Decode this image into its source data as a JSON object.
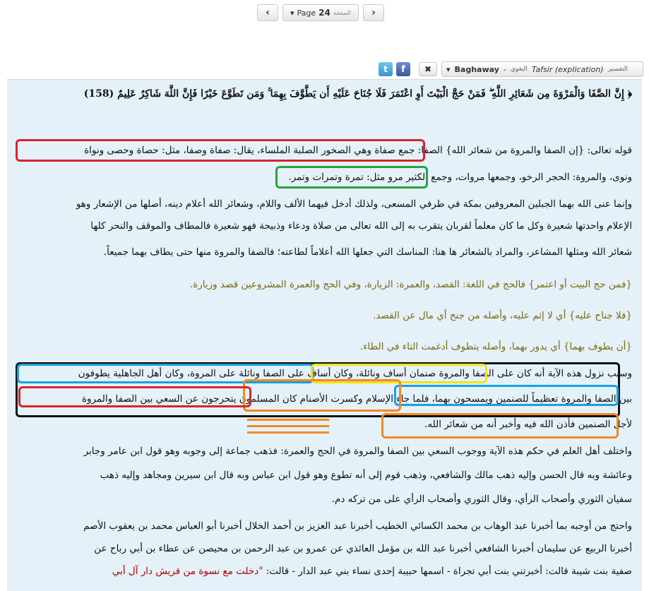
{
  "pager": {
    "prev_symbol": "‹",
    "next_symbol": "›",
    "page_label": "Page",
    "page_number": "24",
    "page_label_ar": "الصفحة",
    "dropdown_symbol": "▾"
  },
  "toolbar": {
    "twitter_label": "t",
    "facebook_label": "f",
    "close_symbol": "✖",
    "book": {
      "name": "Baghaway",
      "separator": "-",
      "name_ar": "البغوي",
      "type": "Tafsir (explication)",
      "type_ar": "التفسير",
      "dropdown_symbol": "▾"
    }
  },
  "content": {
    "lines": [
      "﴿ إِنَّ الصَّفَا وَالْمَرْوَةَ مِن شَعَائِرِ اللَّهِ ۖ فَمَنْ حَجَّ الْبَيْتَ أَوِ اعْتَمَرَ فَلَا جُنَاحَ عَلَيْهِ أَن يَطَّوَّفَ بِهِمَا ۚ وَمَن تَطَوَّعَ خَيْرًا فَإِنَّ اللَّهَ شَاكِرٌ عَلِيمٌ (158)",
      "قوله تعالى: {إن الصفا والمروة من شعائر الله} الصفا: جمع صفاة وهي الصخور الصلبة الملساء، يقال: صفاة وصفا، مثل: حصاة وحصى ونواة",
      "ونوى، والمروة: الحجر الرخو، وجمعها مروات، وجمع الكثير مرو مثل: تمرة وتمرات وتمر.",
      "وإنما عنى الله بهما الجبلين المعروفين بمكة في طرفي المسعى، ولذلك أدخل فيهما الألف واللام، وشعائر الله أعلام دينه، أصلها من الإشعار وهو",
      "الإعلام واحدتها شعيرة وكل ما كان معلماً لقربان يتقرب به إلى الله تعالى من صلاة ودعاء وذبيحة فهو شعيرة فالمطاف والموقف والنحر كلها",
      "شعائر الله ومثلها المشاعر، والمراد بالشعائر ها هنا: المناسك التي جعلها الله أعلاماً لطاعته؛ فالصفا والمروة منها حتى يطاف بهما جميعاً.",
      "{فمن حج البيت أو اعتمر} فالحج في اللغة: القصد، والعمرة: الزيارة، وفي الحج والعمرة المشروعين قصد وزيارة.",
      "{فلا جناح عليه} أي لا إثم عليه، وأصله من جنح أي مال عن القصد.",
      "{أن يطوف بهما} أي يدور بهما، وأصله يتطوف أدغمت التاء في الطاء.",
      "وسبب نزول هذه الآية أنه كان على الصفا والمروة صنمان أساف ونائلة، وكان أساف على الصفا ونائلة على المروة، وكان أهل الجاهلية يطوفون",
      "بين الصفا والمروة تعظيماً للصنمين ويمسحون بهما، فلما جاء الإسلام وكسرت الأصنام كان المسلمون يتحرجون عن السعي بين الصفا والمروة",
      "لأجل الصنمين فأذن الله فيه وأخبر أنه من شعائر الله.",
      "واختلف أهل العلم في حكم هذه الآية ووجوب السعي بين الصفا والمروة في الحج والعمرة: فذهب جماعة إلى وجوبه وهو قول ابن عامر وجابر",
      "وعائشة وبه قال الحسن وإليه ذهب مالك والشافعي، وذهب قوم إلى أنه تطوع وهو قول ابن عباس وبه قال ابن سيرين ومجاهد وإليه ذهب",
      "سفيان الثوري وأصحاب الرأي، وقال الثوري وأصحاب الرأي على من تركه دم.",
      "واحتج من أوجبه بما أخبرنا عبد الوهاب بن محمد الكسائي الخطيب أخبرنا عبد العزيز بن أحمد الخلال أخبرنا أبو العباس محمد بن يعقوب الأصم",
      "أخبرنا الربيع عن سليمان أخبرنا الشافعي أخبرنا عبد الله بن مؤمل العائذي عن عمرو بن عبد الرحمن بن محيصن عن عطاء بن أبي رباح عن",
      "صفية بنت شيبة قالت: أخبرتني بنت أبي تجراة - اسمها حبيبة إحدى نساء بني عبد الدار - قالت:",
      "\"دخلت مع نسوة من قريش دار آل أبي"
    ]
  }
}
